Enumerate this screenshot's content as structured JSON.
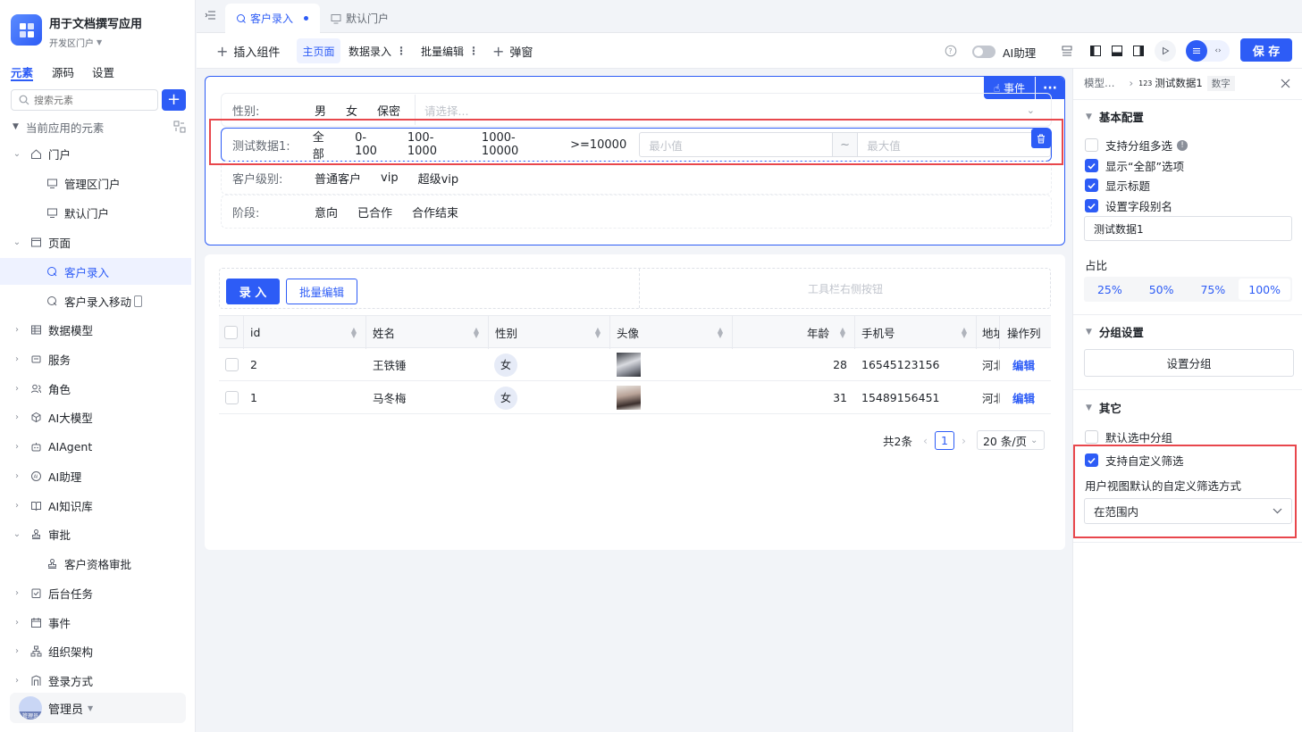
{
  "app": {
    "name": "用于文档撰写应用",
    "portal": "开发区门户"
  },
  "side_tabs": [
    "元素",
    "源码",
    "设置"
  ],
  "search": {
    "placeholder": "搜索元素"
  },
  "tree": {
    "header": "当前应用的元素",
    "items": [
      {
        "label": "门户"
      },
      {
        "label": "管理区门户"
      },
      {
        "label": "默认门户"
      },
      {
        "label": "页面"
      },
      {
        "label": "客户录入"
      },
      {
        "label": "客户录入移动"
      },
      {
        "label": "数据模型"
      },
      {
        "label": "服务"
      },
      {
        "label": "角色"
      },
      {
        "label": "AI大模型"
      },
      {
        "label": "AIAgent"
      },
      {
        "label": "AI助理"
      },
      {
        "label": "AI知识库"
      },
      {
        "label": "审批"
      },
      {
        "label": "客户资格审批"
      },
      {
        "label": "后台任务"
      },
      {
        "label": "事件"
      },
      {
        "label": "组织架构"
      },
      {
        "label": "登录方式"
      }
    ]
  },
  "user": {
    "name": "管理员",
    "avatar_text": "管理员"
  },
  "tabs": [
    {
      "label": "客户录入"
    },
    {
      "label": "默认门户"
    }
  ],
  "toolbar": {
    "insert": "插入组件",
    "main_page": "主页面",
    "data_entry": "数据录入",
    "batch_edit": "批量编辑",
    "popup": "弹窗",
    "ai_assistant": "AI助理",
    "save": "保 存"
  },
  "filter": {
    "event_btn": "事件",
    "rows": [
      {
        "label": "性别:",
        "options": [
          "男",
          "女",
          "保密"
        ],
        "select_placeholder": "请选择..."
      },
      {
        "label": "测试数据1:",
        "options": [
          "全部",
          "0-100",
          "100-1000",
          "1000-10000",
          ">=10000"
        ],
        "min_placeholder": "最小值",
        "sep": "~",
        "max_placeholder": "最大值"
      },
      {
        "label": "客户级别:",
        "options": [
          "普通客户",
          "vip",
          "超级vip"
        ]
      },
      {
        "label": "阶段:",
        "options": [
          "意向",
          "已合作",
          "合作结束"
        ]
      }
    ]
  },
  "table": {
    "enter_btn": "录 入",
    "batch_btn": "批量编辑",
    "right_toolbar": "工具栏右侧按钮",
    "columns": [
      "id",
      "姓名",
      "性别",
      "头像",
      "年龄",
      "手机号",
      "地址",
      "操作列"
    ],
    "rows": [
      {
        "id": "2",
        "name": "王铁锤",
        "gender": "女",
        "age": "28",
        "phone": "16545123156",
        "addr": "河北",
        "action": "编辑"
      },
      {
        "id": "1",
        "name": "马冬梅",
        "gender": "女",
        "age": "31",
        "phone": "15489156451",
        "addr": "河北",
        "action": "编辑"
      }
    ],
    "total": "共2条",
    "page": "1",
    "page_size": "20 条/页"
  },
  "panel": {
    "breadcrumb_model": "模型…",
    "breadcrumb_field": "测试数据1",
    "breadcrumb_type": "数字",
    "basic_title": "基本配置",
    "opt_multi": "支持分组多选",
    "opt_all": "显示“全部”选项",
    "opt_title": "显示标题",
    "opt_alias": "设置字段别名",
    "alias_value": "测试数据1",
    "ratio_label": "占比",
    "ratios": [
      "25%",
      "50%",
      "75%",
      "100%"
    ],
    "group_title": "分组设置",
    "group_btn": "设置分组",
    "other_title": "其它",
    "opt_default_group": "默认选中分组",
    "opt_custom_filter": "支持自定义筛选",
    "custom_filter_label": "用户视图默认的自定义筛选方式",
    "custom_filter_value": "在范围内"
  },
  "colors": {
    "primary": "#2d5cf6",
    "highlight": "#e8474c"
  }
}
